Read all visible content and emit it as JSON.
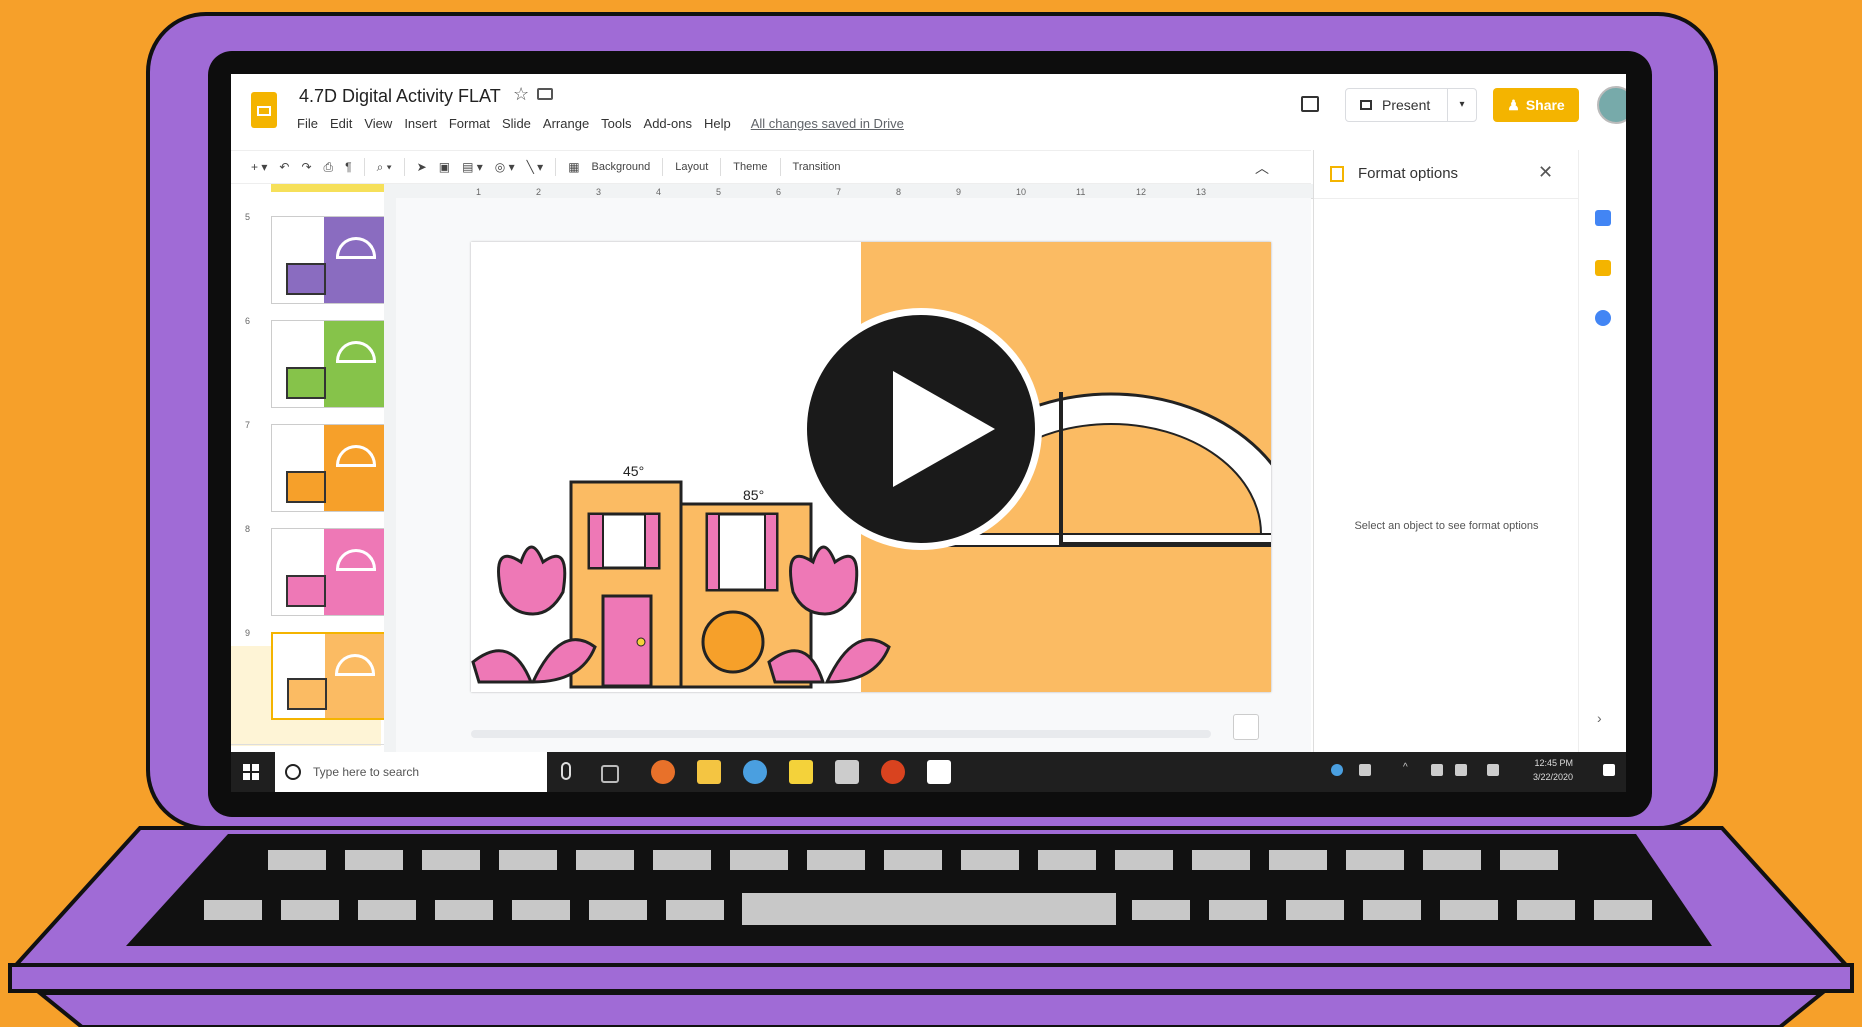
{
  "doc": {
    "title": "4.7D Digital Activity FLAT",
    "star": "☆",
    "menu": [
      "File",
      "Edit",
      "View",
      "Insert",
      "Format",
      "Slide",
      "Arrange",
      "Tools",
      "Add-ons",
      "Help"
    ],
    "saved_status": "All changes saved in Drive"
  },
  "header": {
    "present_label": "Present",
    "share_label": "Share"
  },
  "toolbar": {
    "background_label": "Background",
    "layout_label": "Layout",
    "theme_label": "Theme",
    "transition_label": "Transition"
  },
  "ruler_ticks": [
    "1",
    "2",
    "3",
    "4",
    "5",
    "6",
    "7",
    "8",
    "9",
    "10",
    "11",
    "12",
    "13"
  ],
  "filmstrip": {
    "slides": [
      {
        "number": "5",
        "color": "#8a6cc0"
      },
      {
        "number": "6",
        "color": "#86c34a"
      },
      {
        "number": "7",
        "color": "#f6a02a"
      },
      {
        "number": "8",
        "color": "#ee78b6"
      },
      {
        "number": "9",
        "color": "#fbbb63"
      }
    ],
    "selected": "9"
  },
  "slide": {
    "angle_left": "45°",
    "angle_right": "85°"
  },
  "format_panel": {
    "title": "Format options",
    "message": "Select an object to see format options"
  },
  "taskbar": {
    "search_placeholder": "Type here to search",
    "time": "12:45 PM",
    "date": "3/22/2020"
  },
  "colors": {
    "background": "#f6a02a",
    "laptop": "#a06bd6",
    "accent": "#f4b400",
    "slide_orange": "#fbbb63",
    "pink": "#ee78b6"
  }
}
